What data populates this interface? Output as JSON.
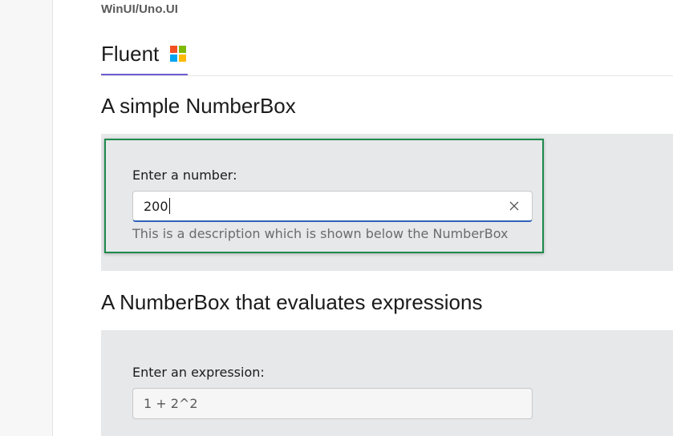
{
  "breadcrumb": "WinUI/Uno.UI",
  "tabs": [
    {
      "label": "Fluent",
      "selected": true,
      "icon": "microsoft-logo-icon"
    }
  ],
  "logo_colors": [
    "#f25022",
    "#7fba00",
    "#00a4ef",
    "#ffb900"
  ],
  "section1": {
    "title": "A simple NumberBox",
    "header": "Enter a number:",
    "value": "200",
    "description": "This is a description which is shown below the NumberBox",
    "clear_icon": "close-icon"
  },
  "section2": {
    "title": "A NumberBox that evaluates expressions",
    "header": "Enter an expression:",
    "value": "1 + 2^2"
  },
  "colors": {
    "highlight_border": "#1e8a4a",
    "focus_underline": "#2f63b9",
    "tab_underline": "#6e5fcf",
    "panel_bg": "#e6e8ea"
  }
}
